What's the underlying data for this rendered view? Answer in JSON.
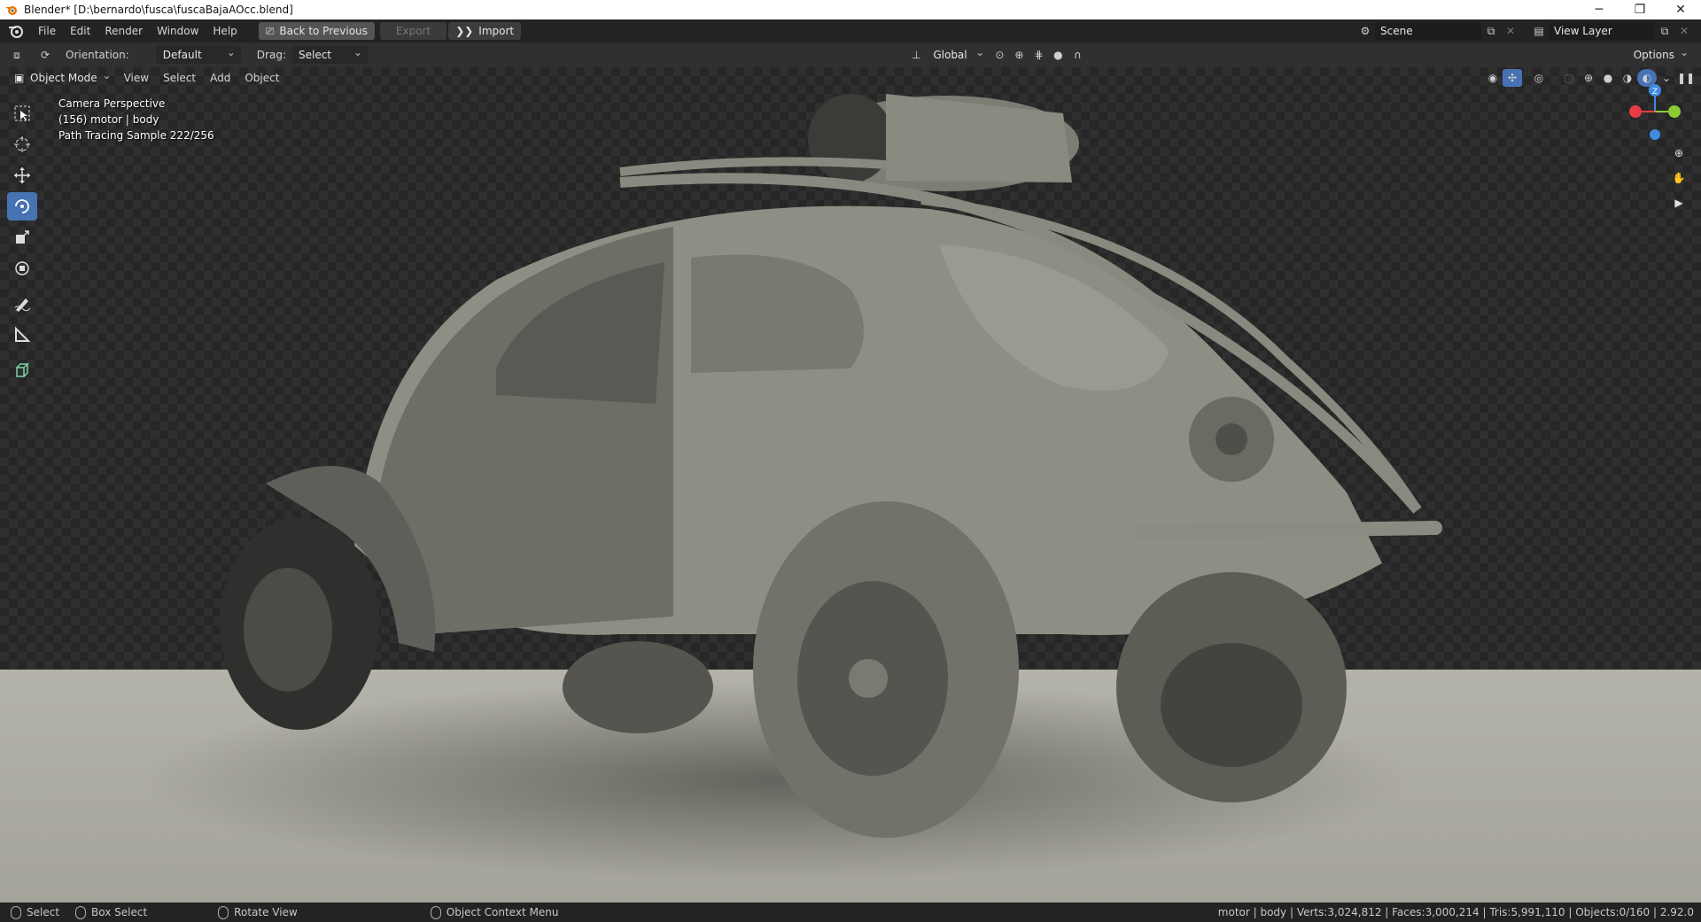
{
  "window": {
    "title": "Blender* [D:\\bernardo\\fusca\\fuscaBajaAOcc.blend]",
    "controls": [
      "─",
      "❐",
      "✕"
    ]
  },
  "topbar": {
    "menus": [
      "File",
      "Edit",
      "Render",
      "Window",
      "Help"
    ],
    "back_to_previous": "Back to Previous",
    "export": "Export",
    "import": "Import",
    "scene_name": "Scene",
    "view_layer": "View Layer"
  },
  "tool_header": {
    "orientation_label": "Orientation:",
    "orientation_value": "Default",
    "drag_label": "Drag:",
    "drag_value": "Select Box",
    "transform_orientation": "Global",
    "options": "Options"
  },
  "viewport_header": {
    "mode": "Object Mode",
    "menus": [
      "View",
      "Select",
      "Add",
      "Object"
    ]
  },
  "overlay": {
    "line1": "Camera Perspective",
    "line2": "(156) motor | body",
    "line3": "Path Tracing Sample 222/256"
  },
  "gizmo": {
    "z_label": "Z",
    "colors": {
      "x": "#e83d45",
      "y": "#8dcb34",
      "z": "#3f8ae0"
    }
  },
  "statusbar": {
    "select": "Select",
    "box_select": "Box Select",
    "rotate_view": "Rotate View",
    "context_menu": "Object Context Menu",
    "stats": "motor | body | Verts:3,024,812 | Faces:3,000,214 | Tris:5,991,110 | Objects:0/160 | 2.92.0"
  },
  "colors": {
    "accent": "#4772b3",
    "header_bg": "#303030",
    "topbar_bg": "#232323",
    "model_clay": "#8f8e84"
  }
}
